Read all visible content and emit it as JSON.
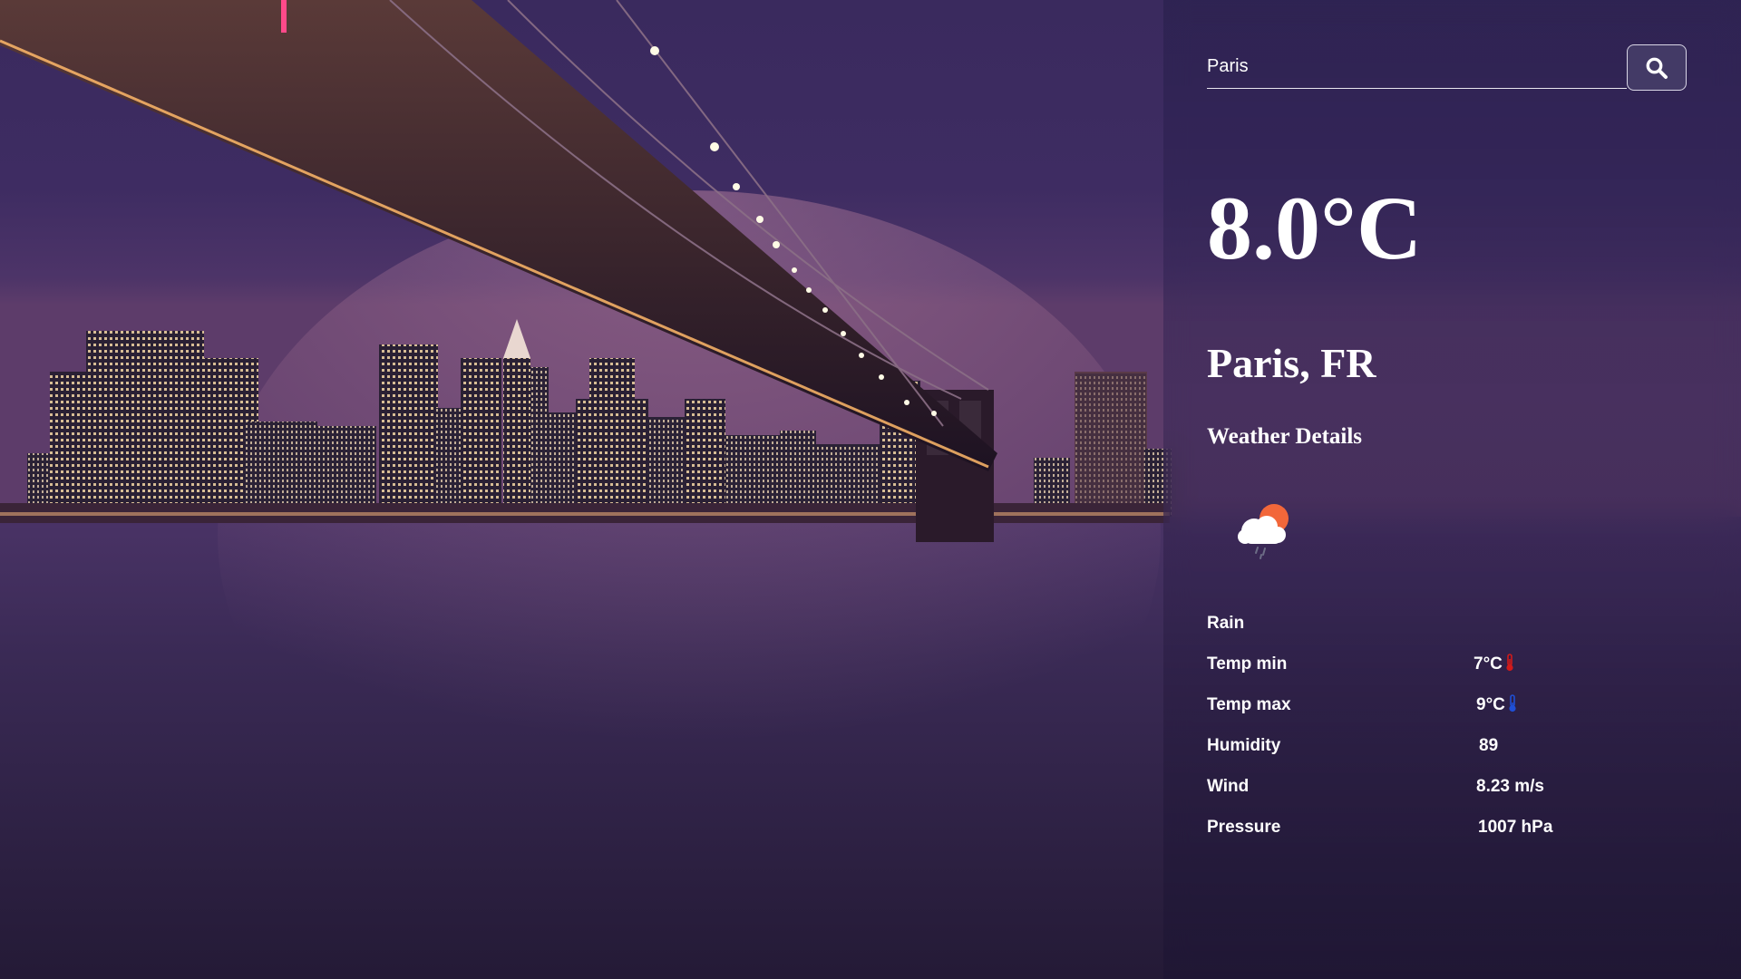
{
  "search": {
    "value": "Paris",
    "button_icon": "search-icon"
  },
  "weather": {
    "temperature": "8.0°C",
    "location": "Paris, FR",
    "details_heading": "Weather Details",
    "condition_icon": "sun-cloud-rain-icon",
    "condition": "Rain",
    "details": [
      {
        "label": "Temp min",
        "value": "7°C",
        "icon": "thermometer-hot-icon",
        "icon_color": "#d11a1a"
      },
      {
        "label": "Temp max",
        "value": "9°C",
        "icon": "thermometer-cold-icon",
        "icon_color": "#1f4fd6"
      },
      {
        "label": "Humidity",
        "value": "89"
      },
      {
        "label": "Wind",
        "value": "8.23 m/s"
      },
      {
        "label": "Pressure",
        "value": "1007 hPa"
      }
    ]
  },
  "colors": {
    "sky": "#2f2050",
    "panel_tint": "#261e4a",
    "text": "#ffffff"
  }
}
